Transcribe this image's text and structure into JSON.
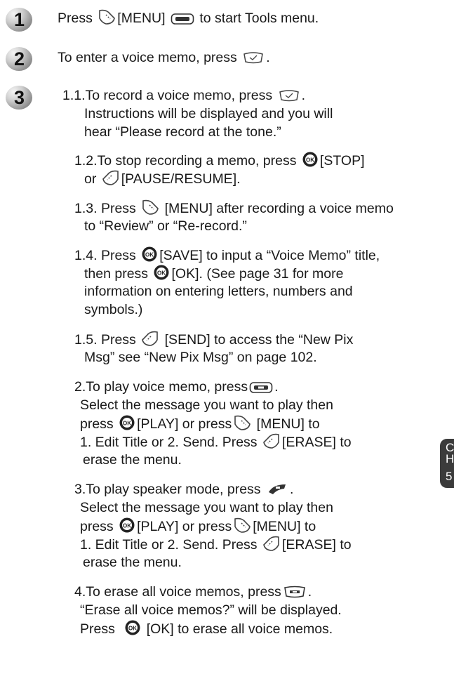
{
  "steps": [
    {
      "num": "1"
    },
    {
      "num": "2"
    },
    {
      "num": "3"
    }
  ],
  "lines": {
    "s1": [
      "Press",
      "[MENU]",
      "to start Tools menu."
    ],
    "s2": [
      "To enter a voice memo, press",
      "."
    ],
    "s3a": [
      "1.1.To record a voice memo, press",
      "."
    ],
    "s3b": "Instructions will be displayed and you will",
    "s3c": "hear “Please record at the tone.”",
    "s4a": [
      "1.2.To stop recording a memo, press",
      "[STOP]"
    ],
    "s4b": [
      "or",
      "[PAUSE/RESUME]."
    ],
    "s5a": [
      "1.3. Press",
      "[MENU] after recording a voice memo"
    ],
    "s5b": "to “Review” or “Re-record.”",
    "s6a": [
      "1.4. Press",
      "[SAVE] to input a “Voice Memo” title,"
    ],
    "s6b": [
      "then press",
      "[OK]. (See page 31 for more"
    ],
    "s6c": "information on entering letters, numbers and",
    "s6d": "symbols.)",
    "s7a": [
      "1.5. Press",
      "[SEND] to access the “New Pix"
    ],
    "s7b": "Msg” see “New Pix Msg” on page 102.",
    "s8a": [
      "2.To play voice memo, press",
      "."
    ],
    "s8b": "Select the message you want to play then",
    "s8c": [
      "press",
      "[PLAY] or press",
      "[MENU] to"
    ],
    "s8d": [
      "1. Edit Title or 2. Send. Press",
      "[ERASE] to"
    ],
    "s8e": "erase the menu.",
    "s9a": [
      "3.To play speaker mode, press",
      "."
    ],
    "s9b": "Select the message you want to play then",
    "s9c": [
      "press",
      "[PLAY] or press",
      "[MENU] to"
    ],
    "s9d": [
      "1. Edit Title or 2. Send. Press",
      "[ERASE] to"
    ],
    "s9e": "erase the menu.",
    "s10a": [
      "4.To erase all voice memos, press",
      "."
    ],
    "s10b": "“Erase all voice memos?” will be displayed.",
    "s10c": [
      "Press",
      "[OK] to erase all voice memos."
    ]
  },
  "side_tab": {
    "line1": "C",
    "line2": "H",
    "line3": "5"
  },
  "icons": {
    "menu_softkey": "left-softkey-icon",
    "right_softkey": "right-softkey-icon",
    "ok_key": "ok-key-icon",
    "menu_button": "menu-button-icon",
    "voice_key": "voice-memo-key-icon",
    "play_key": "play-key-icon",
    "speaker_key": "speaker-key-icon",
    "erase_key": "erase-key-icon"
  }
}
